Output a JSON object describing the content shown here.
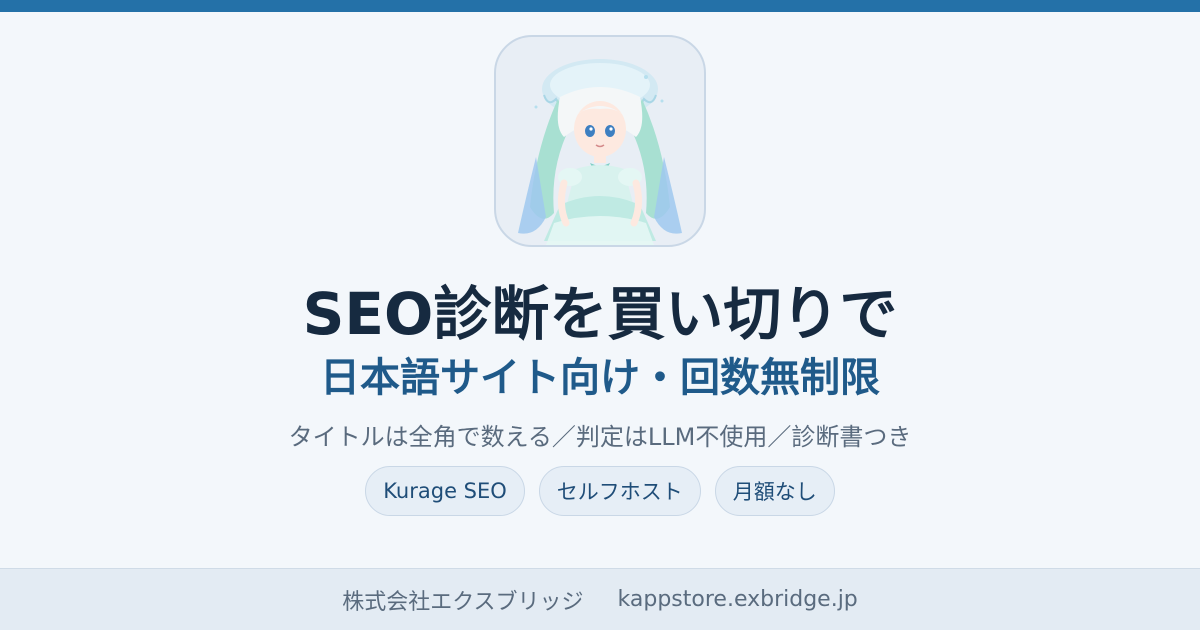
{
  "header": {
    "accent_color": "#2471a8"
  },
  "avatar": {
    "icon": "jellyfish-girl-avatar"
  },
  "title": {
    "main": "SEO診断を買い切りで",
    "sub": "日本語サイト向け・回数無制限"
  },
  "tagline": "タイトルは全角で数える／判定はLLM不使用／診断書つき",
  "chips": [
    "Kurage SEO",
    "セルフホスト",
    "月額なし"
  ],
  "footer": {
    "company": "株式会社エクスブリッジ",
    "url": "kappstore.exbridge.jp"
  },
  "colors": {
    "background": "#f3f7fb",
    "title": "#162a40",
    "subtitle": "#1f5a8a",
    "muted_text": "#5a6b7e",
    "chip_text": "#1f4d78"
  }
}
